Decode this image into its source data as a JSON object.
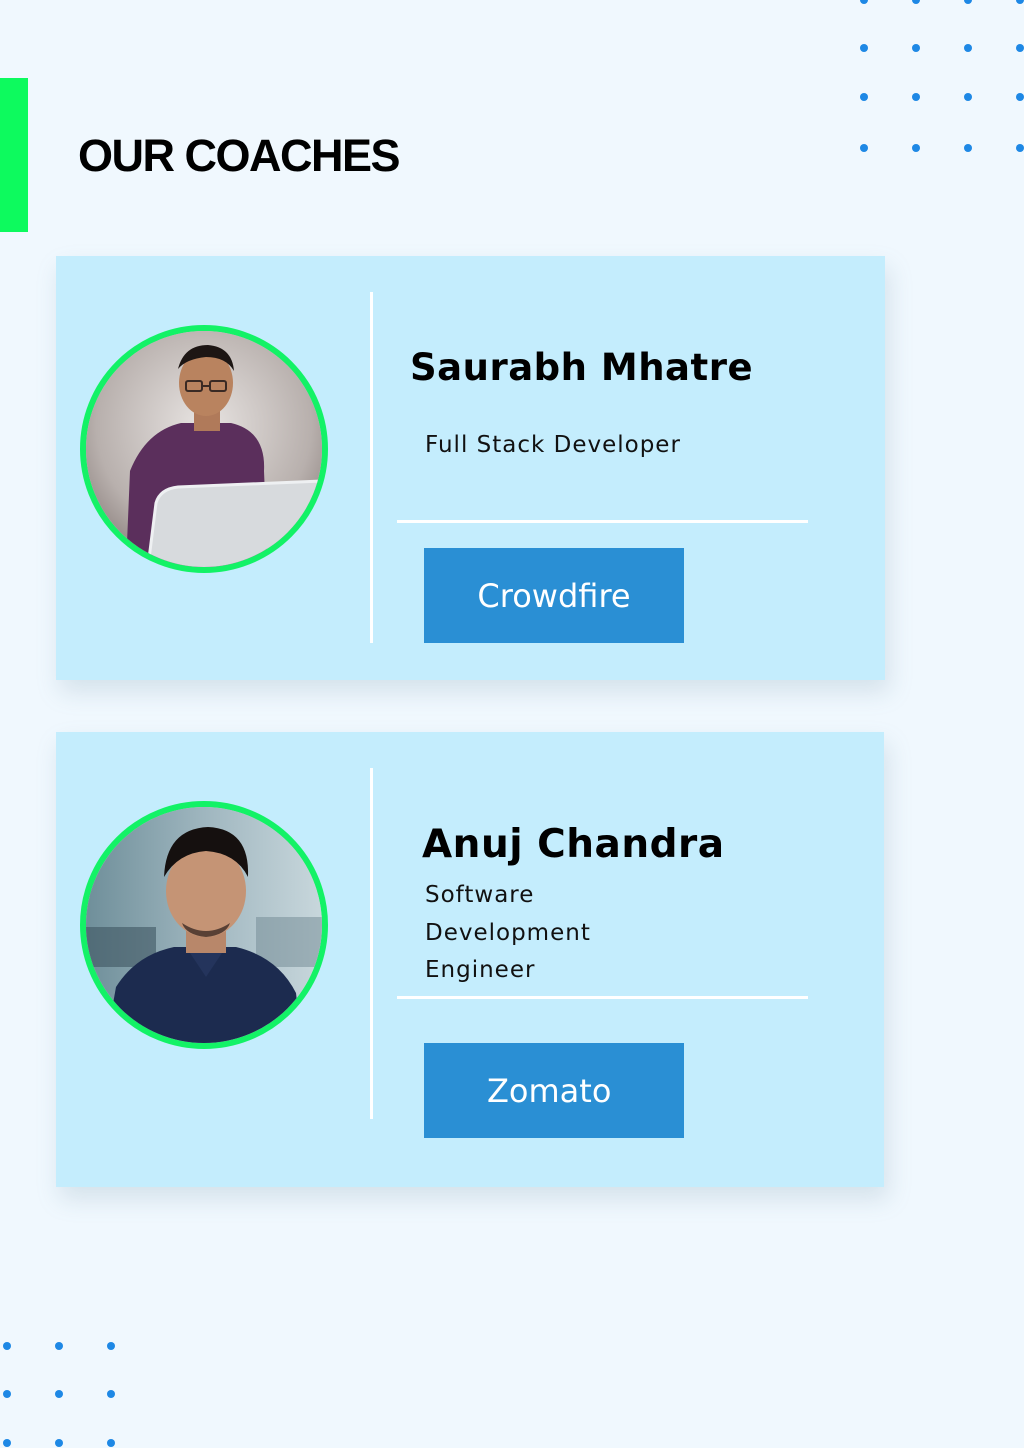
{
  "page": {
    "title": "OUR COACHES"
  },
  "colors": {
    "background": "#f0f8fe",
    "accent_green": "#0dfa5e",
    "card": "#c4edfd",
    "button": "#2a8fd4",
    "dots": "#1e88e5"
  },
  "coaches": [
    {
      "name": "Saurabh Mhatre",
      "role": "Full Stack Developer",
      "company": "Crowdfire"
    },
    {
      "name": "Anuj Chandra",
      "role": "Software Development Engineer",
      "company": "Zomato"
    }
  ]
}
